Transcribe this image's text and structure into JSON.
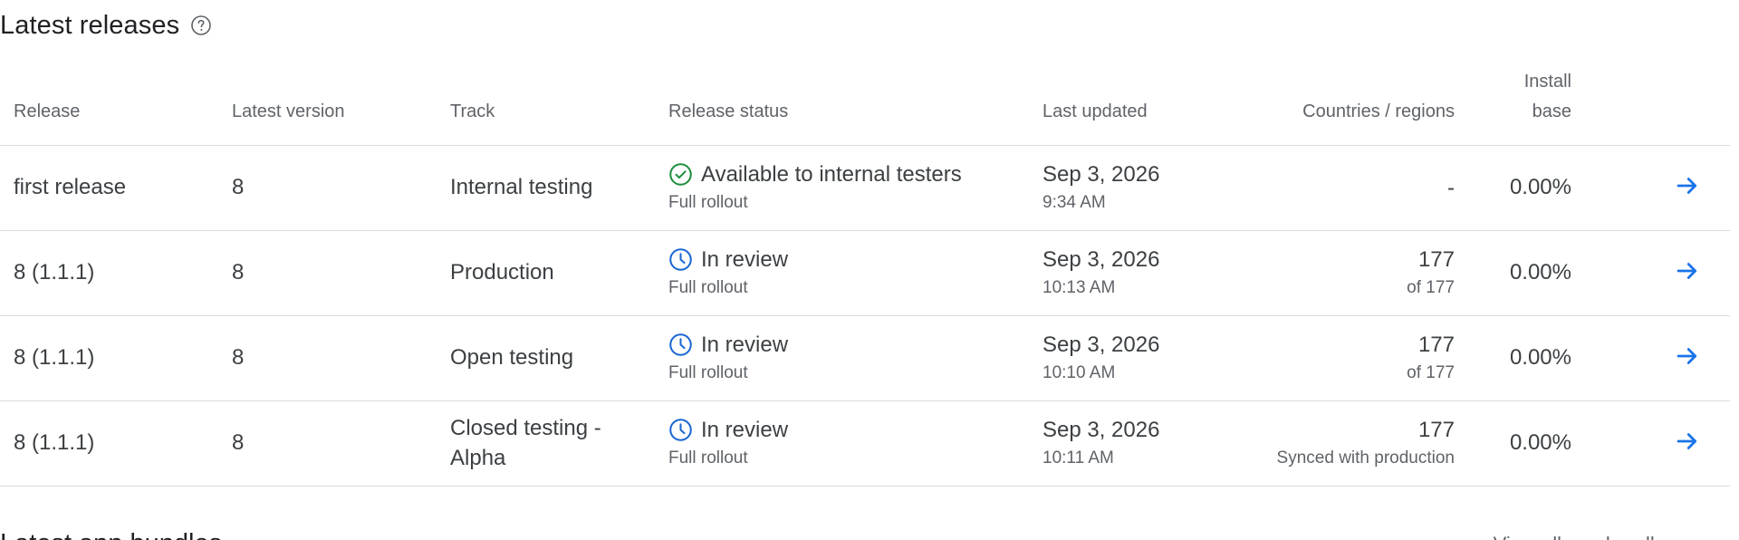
{
  "section": {
    "title": "Latest releases",
    "help_icon": "help-circle-icon"
  },
  "table": {
    "headers": {
      "release": "Release",
      "latest_version": "Latest version",
      "track": "Track",
      "release_status": "Release status",
      "last_updated": "Last updated",
      "countries": "Countries / regions",
      "install_base_line1": "Install",
      "install_base_line2": "base"
    },
    "rows": [
      {
        "release": "first release",
        "latest_version": "8",
        "track": "Internal testing",
        "status": "Available to internal testers",
        "status_icon": "check-circle-icon",
        "rollout": "Full rollout",
        "date": "Sep 3, 2026",
        "time": "9:34 AM",
        "countries": "-",
        "countries_sub": "",
        "install_base": "0.00%",
        "action_icon": "arrow-right-icon"
      },
      {
        "release": "8 (1.1.1)",
        "latest_version": "8",
        "track": "Production",
        "status": "In review",
        "status_icon": "clock-icon",
        "rollout": "Full rollout",
        "date": "Sep 3, 2026",
        "time": "10:13 AM",
        "countries": "177",
        "countries_sub": "of 177",
        "install_base": "0.00%",
        "action_icon": "arrow-right-icon"
      },
      {
        "release": "8 (1.1.1)",
        "latest_version": "8",
        "track": "Open testing",
        "status": "In review",
        "status_icon": "clock-icon",
        "rollout": "Full rollout",
        "date": "Sep 3, 2026",
        "time": "10:10 AM",
        "countries": "177",
        "countries_sub": "of 177",
        "install_base": "0.00%",
        "action_icon": "arrow-right-icon"
      },
      {
        "release": "8 (1.1.1)",
        "latest_version": "8",
        "track_line1": "Closed testing -",
        "track_line2": "Alpha",
        "status": "In review",
        "status_icon": "clock-icon",
        "rollout": "Full rollout",
        "date": "Sep 3, 2026",
        "time": "10:11 AM",
        "countries": "177",
        "countries_sub": "Synced with production",
        "install_base": "0.00%",
        "action_icon": "arrow-right-icon"
      }
    ]
  },
  "next_section": {
    "title": "Latest app bundles",
    "link": "View all app bundles"
  },
  "colors": {
    "success": "#1e8e3e",
    "pending": "#1a73e8",
    "link_arrow": "#1a73e8",
    "divider": "#dadce0"
  }
}
